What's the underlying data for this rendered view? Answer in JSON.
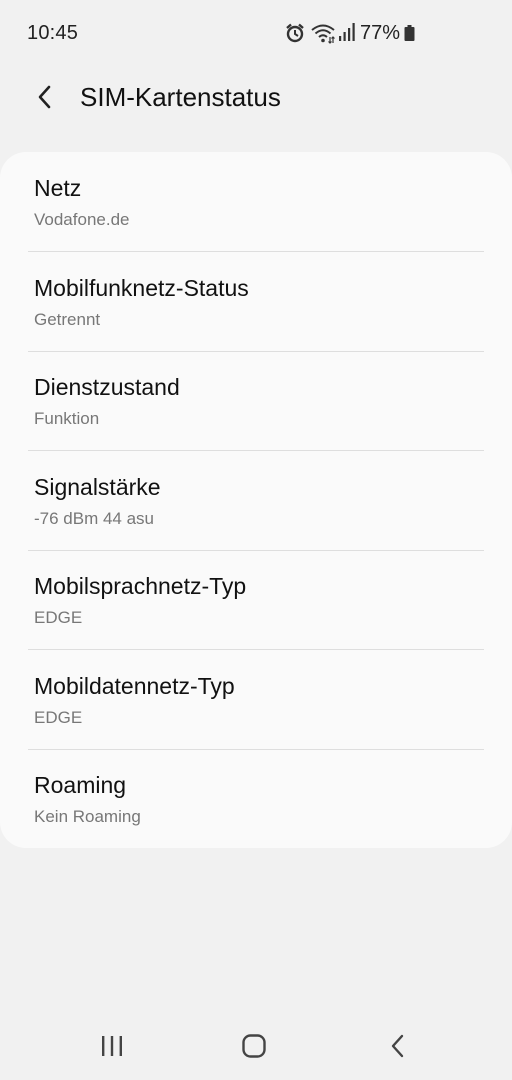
{
  "status_bar": {
    "time": "10:45",
    "battery_percent": "77%",
    "icons": [
      "alarm-icon",
      "wifi-icon",
      "signal-icon",
      "battery-icon"
    ]
  },
  "header": {
    "title": "SIM-Kartenstatus",
    "back_icon": "back-arrow-icon"
  },
  "items": [
    {
      "title": "Netz",
      "value": "Vodafone.de"
    },
    {
      "title": "Mobilfunknetz-Status",
      "value": "Getrennt"
    },
    {
      "title": "Dienstzustand",
      "value": "Funktion"
    },
    {
      "title": "Signalstärke",
      "value": "-76 dBm 44 asu"
    },
    {
      "title": "Mobilsprachnetz-Typ",
      "value": "EDGE"
    },
    {
      "title": "Mobildatennetz-Typ",
      "value": "EDGE"
    },
    {
      "title": "Roaming",
      "value": "Kein Roaming"
    }
  ],
  "nav_bar": {
    "icons": [
      "recent-apps-icon",
      "home-icon",
      "back-icon"
    ]
  },
  "colors": {
    "background": "#f1f1f1",
    "card": "#fafafa",
    "primary_text": "#111111",
    "secondary_text": "#777777",
    "divider": "#dedede"
  }
}
